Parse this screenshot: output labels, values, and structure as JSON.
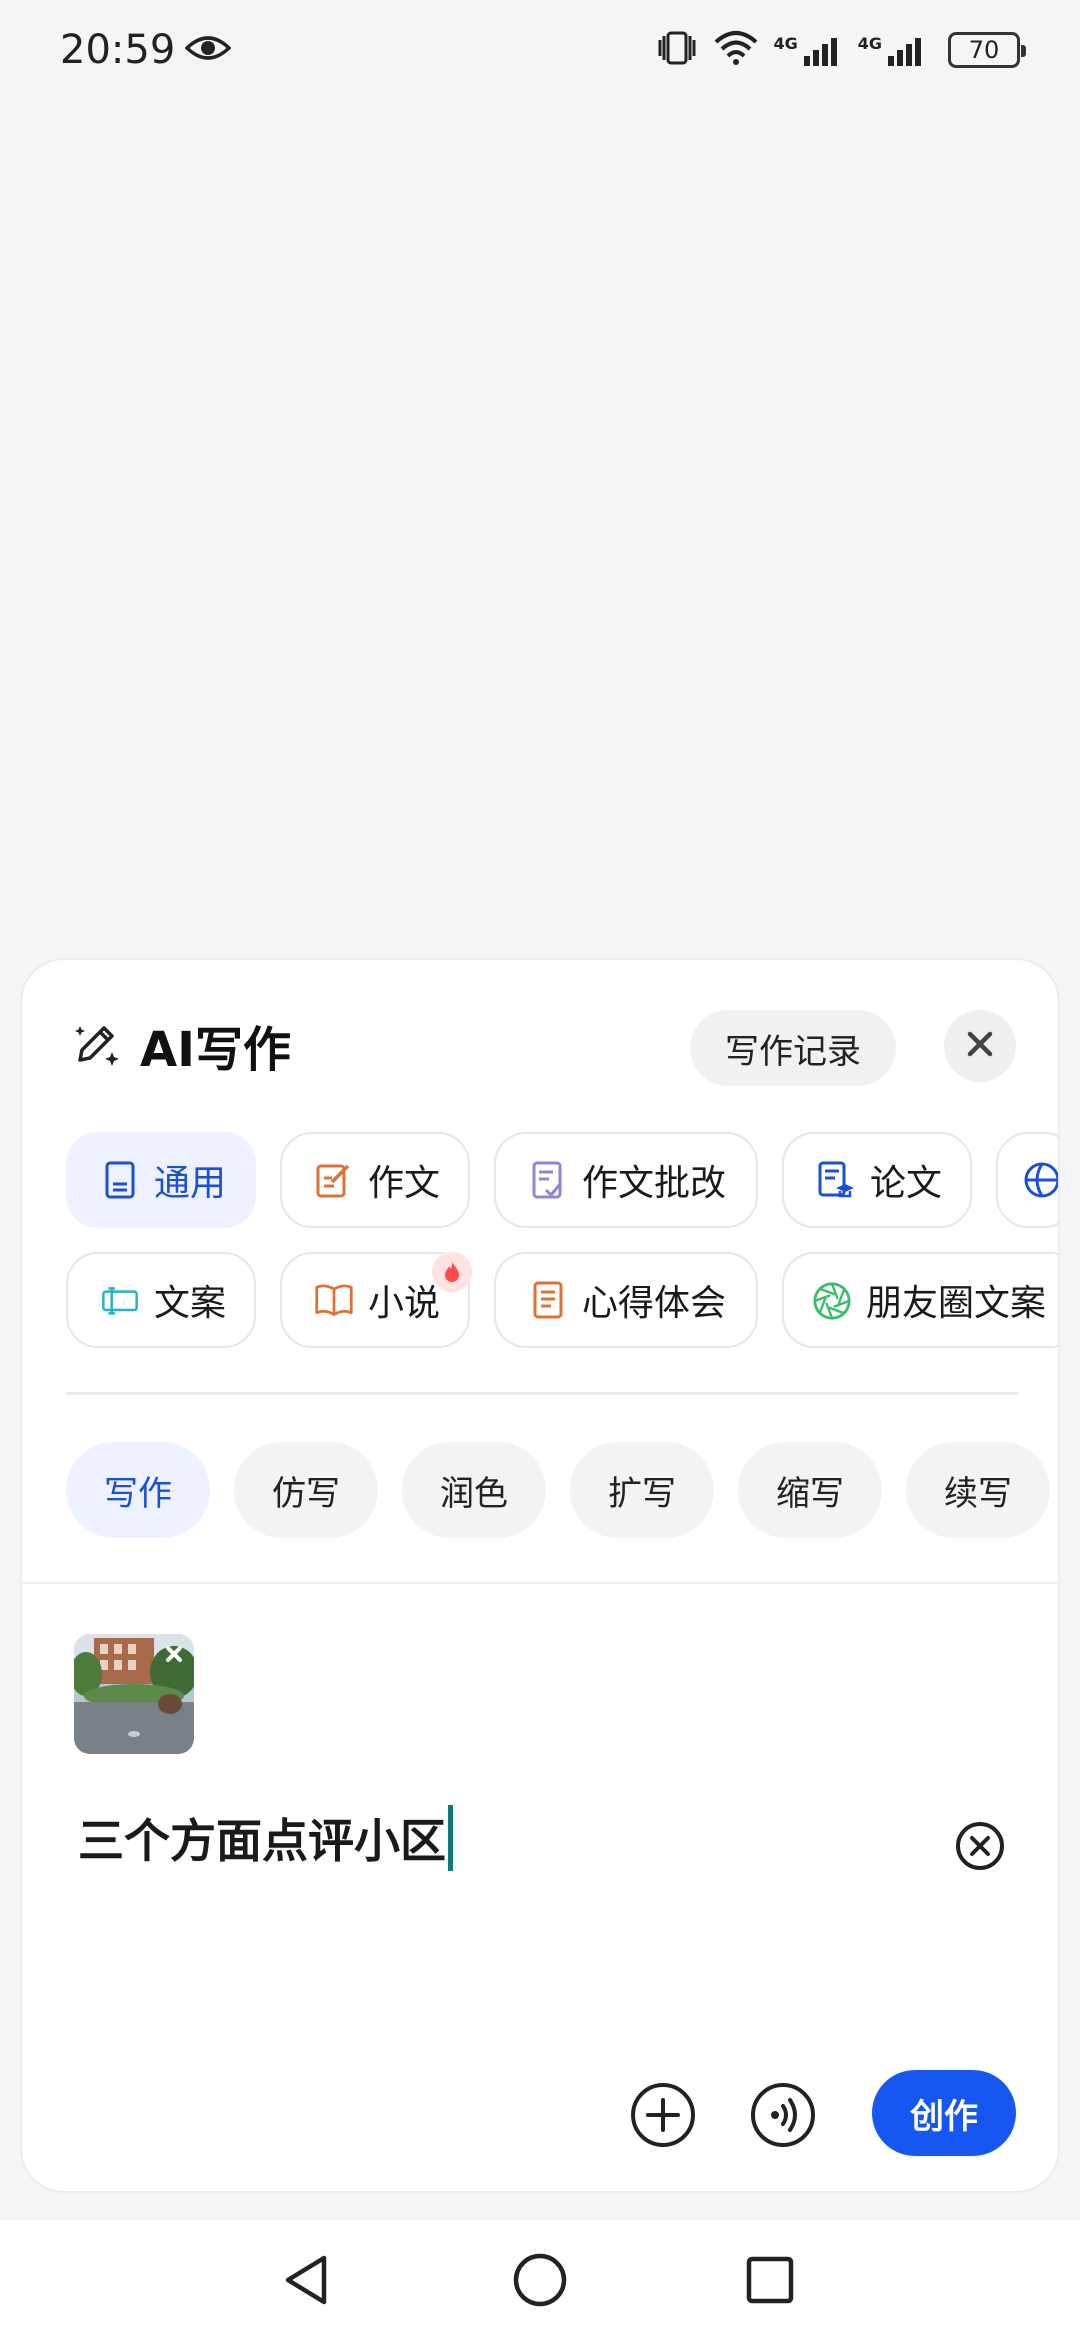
{
  "status_bar": {
    "time": "20:59",
    "net1": "4G",
    "net2": "4G",
    "battery": "70"
  },
  "sheet": {
    "title": "AI写作",
    "history_label": "写作记录",
    "categories_row1": [
      "通用",
      "作文",
      "作文批改",
      "论文"
    ],
    "categories_row2": [
      "文案",
      "小说",
      "心得体会",
      "朋友圈文案"
    ],
    "modes": [
      "写作",
      "仿写",
      "润色",
      "扩写",
      "缩写",
      "续写"
    ],
    "prompt_text": "三个方面点评小区",
    "create_label": "创作"
  },
  "colors": {
    "accent": "#1557f0",
    "active_bg": "#eef1ff",
    "active_text": "#1a4fd6",
    "caret": "#0f7a78"
  },
  "icons": {
    "title": "magic-pen-icon",
    "close": "close-icon",
    "clear": "clear-circle-icon",
    "add": "plus-circle-icon",
    "voice": "voice-icon"
  }
}
